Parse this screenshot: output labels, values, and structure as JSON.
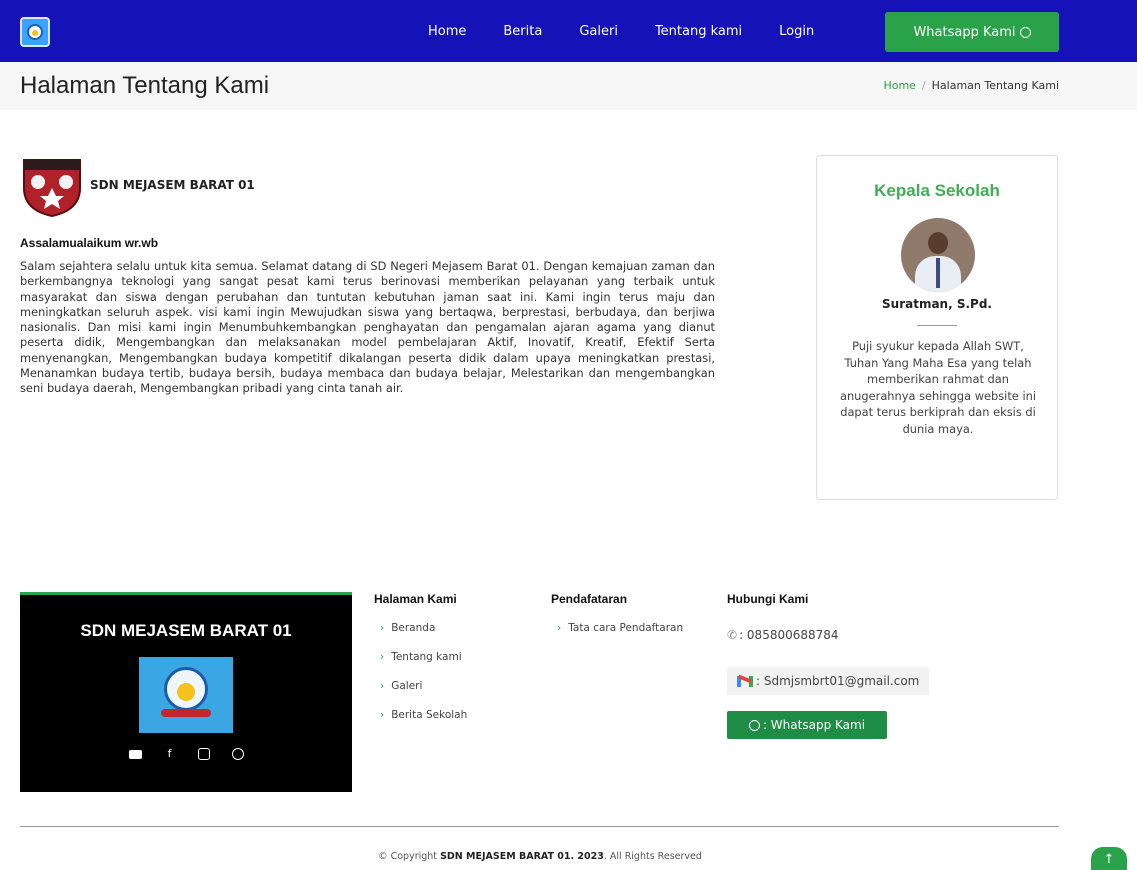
{
  "nav": {
    "items": [
      "Home",
      "Berita",
      "Galeri",
      "Tentang kami",
      "Login"
    ],
    "whatsapp_label": "Whatsapp Kami"
  },
  "header": {
    "title": "Halaman Tentang Kami",
    "breadcrumb_home": "Home",
    "breadcrumb_sep": "/",
    "breadcrumb_current": "Halaman Tentang Kami"
  },
  "about": {
    "school_name": "SDN MEJASEM BARAT 01",
    "greeting": "Assalamualaikum wr.wb",
    "text": "Salam sejahtera selalu untuk kita semua. Selamat datang di SD Negeri Mejasem Barat 01. Dengan kemajuan zaman dan berkembangnya teknologi yang sangat pesat kami terus berinovasi memberikan pelayanan yang terbaik untuk masyarakat dan siswa dengan perubahan dan tuntutan kebutuhan jaman saat ini. Kami ingin terus maju dan meningkatkan seluruh aspek. visi kami ingin Mewujudkan siswa yang bertaqwa, berprestasi, berbudaya, dan berjiwa nasionalis. Dan misi kami ingin Menumbuhkembangkan penghayatan dan pengamalan ajaran agama yang dianut peserta didik, Mengembangkan dan melaksanakan model pembelajaran Aktif, Inovatif, Kreatif, Efektif Serta menyenangkan, Mengembangkan budaya kompetitif dikalangan peserta didik dalam upaya meningkatkan prestasi, Menanamkan budaya tertib, budaya bersih, budaya membaca dan budaya belajar, Melestarikan dan mengembangkan seni budaya daerah, Mengembangkan pribadi yang cinta tanah air."
  },
  "kepala": {
    "title": "Kepala Sekolah",
    "name": "Suratman, S.Pd.",
    "description": "Puji syukur kepada Allah SWT, Tuhan Yang Maha Esa yang telah memberikan rahmat dan anugerahnya sehingga website ini dapat terus berkiprah dan eksis di dunia maya."
  },
  "footer": {
    "brand_name": "SDN MEJASEM BARAT 01",
    "halaman_title": "Halaman Kami",
    "halaman_links": [
      "Beranda",
      "Tentang kami",
      "Galeri",
      "Berita Sekolah"
    ],
    "pendaftaran_title": "Pendafataran",
    "pendaftaran_links": [
      "Tata cara Pendaftaran"
    ],
    "hubungi_title": "Hubungi Kami",
    "phone": ": 085800688784",
    "email": ": Sdmjsmbrt01@gmail.com",
    "whatsapp": ": Whatsapp Kami",
    "copyright_prefix": "© Copyright",
    "copyright_brand": "SDN MEJASEM BARAT 01. 2023",
    "copyright_suffix": ". All Rights Reserved"
  },
  "colors": {
    "nav_bg": "#1512b8",
    "accent_green": "#2aa249",
    "kepala_title": "#3fae55"
  },
  "icons": [
    "youtube-icon",
    "facebook-icon",
    "instagram-icon",
    "whatsapp-icon",
    "phone-icon",
    "gmail-icon",
    "arrow-up-icon"
  ]
}
